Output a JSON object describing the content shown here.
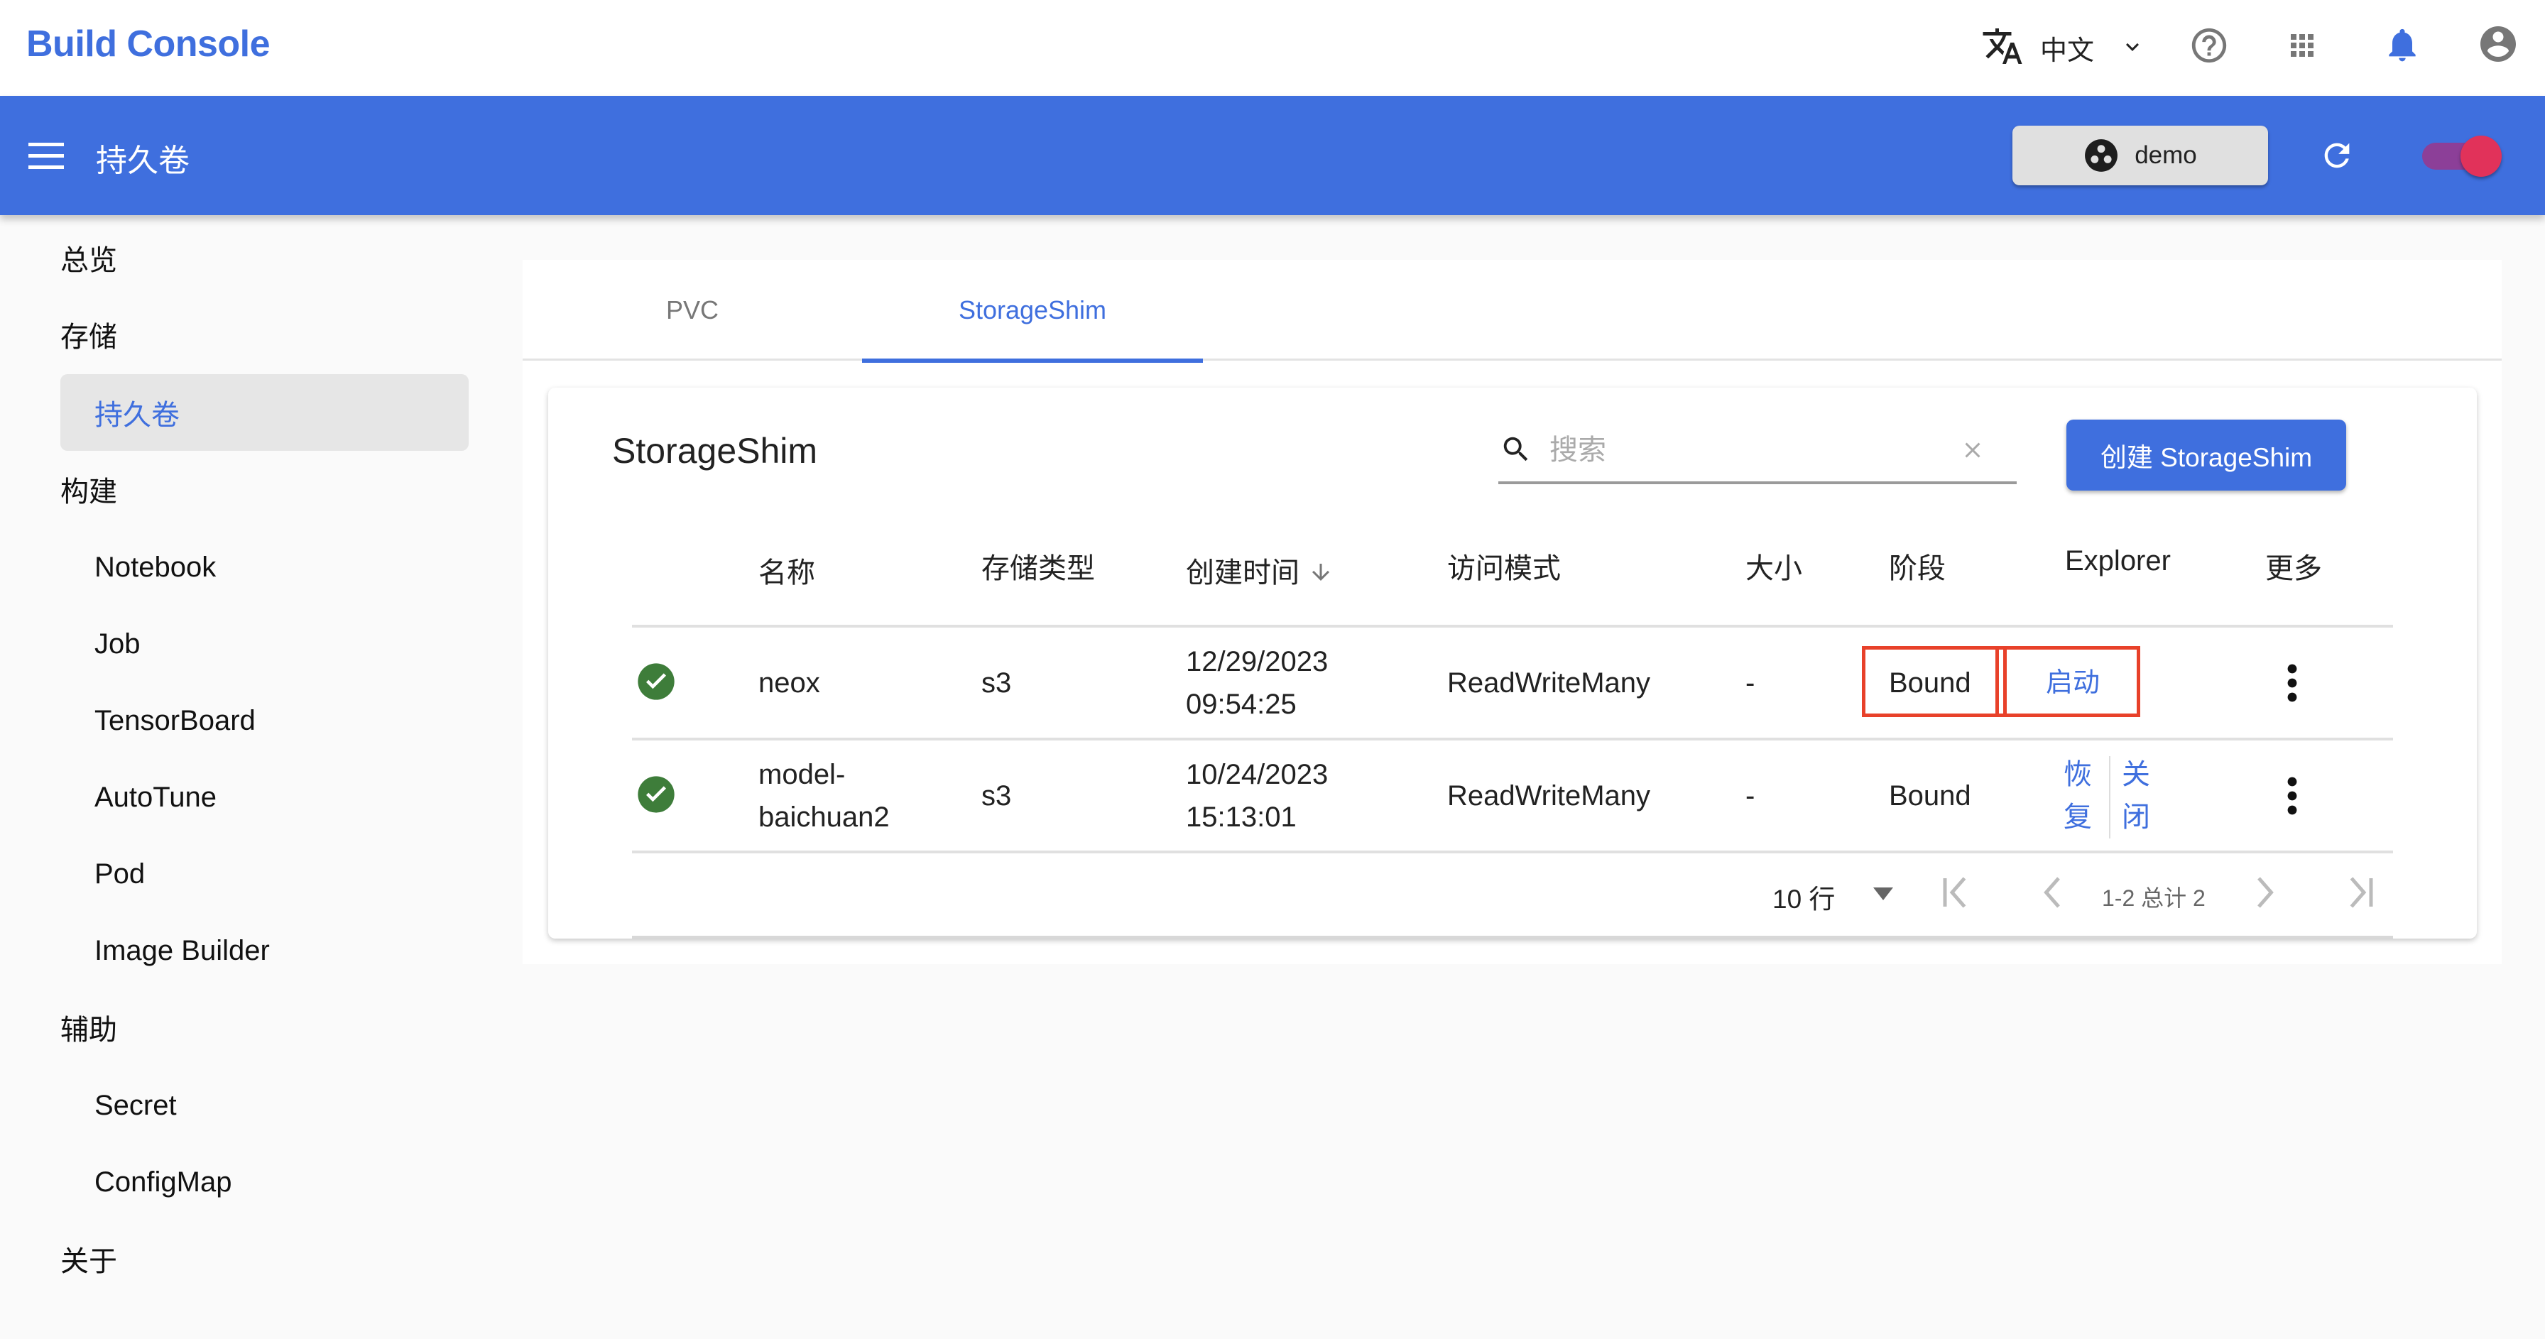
{
  "app": {
    "title": "Build Console",
    "language": "中文",
    "icons": {
      "language": "translate-icon",
      "language_dropdown": "chevron-down-icon",
      "help": "help-circle-icon",
      "apps": "apps-grid-icon",
      "notifications": "bell-icon",
      "account": "account-circle-icon"
    },
    "colors": {
      "primary": "#3f6fde",
      "highlight_box": "#e8412a",
      "success": "#3e7d3a",
      "toggle_track": "#8c3f98",
      "toggle_thumb": "#e1325a"
    }
  },
  "appbar": {
    "page_title": "持久卷",
    "namespace_label": "demo",
    "toggle_on": true
  },
  "sidebar": {
    "items": [
      {
        "label": "总览",
        "level": "group"
      },
      {
        "label": "存储",
        "level": "group"
      },
      {
        "label": "持久卷",
        "level": "sub",
        "selected": true
      },
      {
        "label": "构建",
        "level": "group"
      },
      {
        "label": "Notebook",
        "level": "sub"
      },
      {
        "label": "Job",
        "level": "sub"
      },
      {
        "label": "TensorBoard",
        "level": "sub"
      },
      {
        "label": "AutoTune",
        "level": "sub"
      },
      {
        "label": "Pod",
        "level": "sub"
      },
      {
        "label": "Image Builder",
        "level": "sub"
      },
      {
        "label": "辅助",
        "level": "group"
      },
      {
        "label": "Secret",
        "level": "sub"
      },
      {
        "label": "ConfigMap",
        "level": "sub"
      },
      {
        "label": "关于",
        "level": "group"
      }
    ]
  },
  "tabs": [
    {
      "label": "PVC",
      "active": false
    },
    {
      "label": "StorageShim",
      "active": true
    }
  ],
  "card": {
    "title": "StorageShim",
    "search_placeholder": "搜索",
    "search_value": "",
    "create_button": "创建 StorageShim"
  },
  "table": {
    "columns": [
      "",
      "名称",
      "存储类型",
      "创建时间",
      "访问模式",
      "大小",
      "阶段",
      "Explorer",
      "更多"
    ],
    "sort": {
      "column": "创建时间",
      "direction": "desc"
    },
    "rows": [
      {
        "status": "success",
        "name_line1": "neox",
        "name_line2": "",
        "storage_type": "s3",
        "date": "12/29/2023",
        "time": "09:54:25",
        "access_mode": "ReadWriteMany",
        "size": "-",
        "phase": "Bound",
        "explorer_actions": [
          "启动"
        ],
        "highlighted": true
      },
      {
        "status": "success",
        "name_line1": "model-",
        "name_line2": "baichuan2",
        "storage_type": "s3",
        "date": "10/24/2023",
        "time": "15:13:01",
        "access_mode": "ReadWriteMany",
        "size": "-",
        "phase": "Bound",
        "explorer_actions": [
          "恢复",
          "关闭"
        ],
        "explorer_chars": [
          [
            "恢",
            "复"
          ],
          [
            "关",
            "闭"
          ]
        ],
        "highlighted": false
      }
    ]
  },
  "pagination": {
    "rows_per_page": "10 行",
    "range": "1-2 总计 2"
  }
}
